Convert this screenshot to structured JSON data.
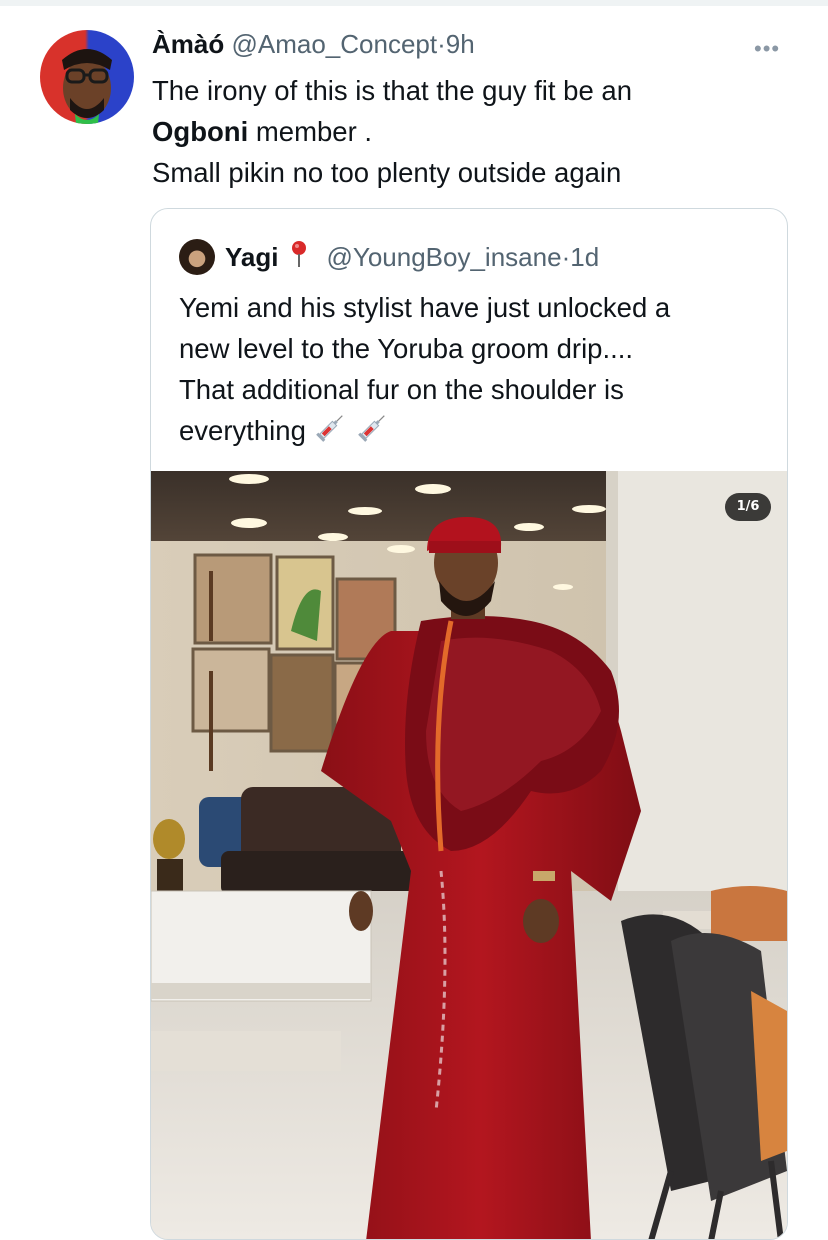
{
  "tweet": {
    "author_name": "Àmàó",
    "author_handle": "@Amao_Concept",
    "separator": "·",
    "time": "9h",
    "more_icon": "more-horizontal-icon",
    "text_line1": "The irony of this is that the guy fit be an",
    "text_bold": "Ogboni",
    "text_line2_rest": " member .",
    "text_line3": "Small pikin no too plenty outside again"
  },
  "quoted_tweet": {
    "author_name": "Yagi",
    "location_icon": "round-pushpin-icon",
    "author_handle": "@YoungBoy_insane",
    "separator": "·",
    "time": "1d",
    "text_line1": "Yemi and his stylist have just unlocked a",
    "text_line2": "new level to the Yoruba groom drip....",
    "text_line3": "That additional fur on the shoulder is",
    "text_line4": "everything",
    "emoji": "syringe-icon",
    "media_counter": "1/6"
  },
  "colors": {
    "text": "#0f1419",
    "secondary": "#536471",
    "border": "#cfd9de",
    "agbada_red": "#a8141c"
  }
}
